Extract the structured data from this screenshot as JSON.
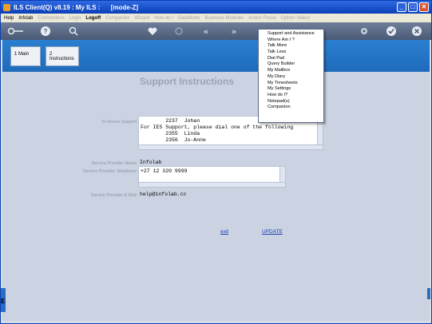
{
  "window": {
    "title": "ILS Client(Q) v8.19 : My ILS :      [mode-Z]",
    "controls": [
      "_",
      "□",
      "✕"
    ]
  },
  "menubar": {
    "items": [
      {
        "label": "Help",
        "state": "normal"
      },
      {
        "label": "Infolab",
        "state": "normal"
      },
      {
        "label": "Connections",
        "state": "dim"
      },
      {
        "label": "Login",
        "state": "dim"
      },
      {
        "label": "Logoff",
        "state": "bold"
      },
      {
        "label": "Companies",
        "state": "dim"
      },
      {
        "label": "Wizard",
        "state": "dim"
      },
      {
        "label": "How do I",
        "state": "dim"
      },
      {
        "label": "DataMarts",
        "state": "dim"
      },
      {
        "label": "Business Modules",
        "state": "dim"
      },
      {
        "label": "Action Focus",
        "state": "dim"
      },
      {
        "label": "Option Select",
        "state": "dim"
      }
    ]
  },
  "toolbar": {
    "icons": [
      "key-icon",
      "help-icon",
      "search-icon",
      "heart-icon",
      "refresh-icon",
      "rewind-icon",
      "forward-icon",
      "gear-icon",
      "check-icon",
      "close-icon"
    ]
  },
  "tabs": [
    {
      "label": "1 Main"
    },
    {
      "label": "2 Instructions"
    }
  ],
  "main": {
    "heading": "Support Instructions",
    "in_house_label": "In-House Support",
    "in_house_text": "        2237  Johan\nFor IES Support, please dial one of the following\n        2355  Linda\n        2356  Jo-Anne",
    "provider_name_label": "Service Provider Name",
    "provider_name_value": "Infolab",
    "provider_phone_label": "Service Provider Telephone",
    "provider_phone_value": "+27 12 320 9999",
    "provider_email_label": "Service Provider E-Mail",
    "provider_email_value": "help@infolab.cc",
    "exit_label": "exit",
    "update_label": "UPDATE"
  },
  "left_strip": {
    "glyph": "E"
  },
  "dropdown": {
    "items": [
      "Support and Assistance",
      "Where Am I ?",
      "Talk More",
      "Talk Less",
      "Dial Pad",
      "Query Builder",
      "My Mailbox",
      "My Diary",
      "My Timesheets",
      "My Settings",
      "How do I?",
      "Notepad(s)",
      "Companion"
    ]
  }
}
